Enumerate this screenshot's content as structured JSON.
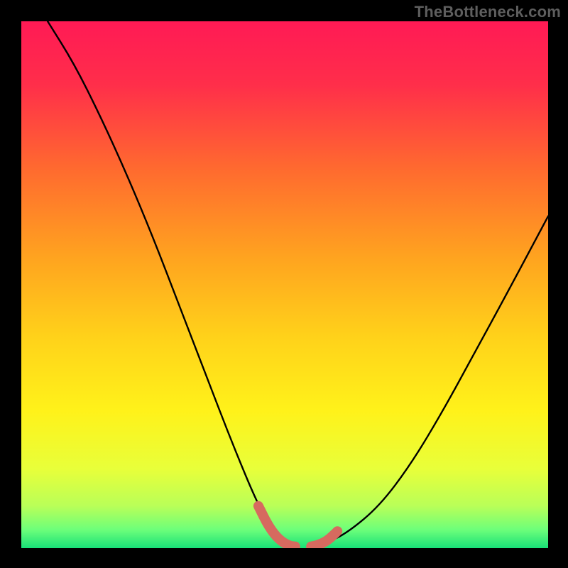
{
  "watermark": "TheBottleneck.com",
  "chart_data": {
    "type": "line",
    "title": "",
    "xlabel": "",
    "ylabel": "",
    "xlim": [
      0,
      100
    ],
    "ylim": [
      0,
      100
    ],
    "grid": false,
    "legend": false,
    "series": [
      {
        "name": "curve-left",
        "x": [
          5,
          10,
          15,
          20,
          25,
          30,
          35,
          40,
          45,
          48,
          50,
          52
        ],
        "y": [
          100,
          92,
          82,
          71,
          59,
          46,
          33,
          20,
          8,
          3,
          1,
          0
        ]
      },
      {
        "name": "curve-right",
        "x": [
          55,
          58,
          62,
          68,
          74,
          80,
          86,
          92,
          100
        ],
        "y": [
          0,
          1,
          3,
          8,
          16,
          26,
          37,
          48,
          63
        ]
      },
      {
        "name": "highlight-left",
        "x": [
          45,
          47,
          49,
          51,
          52
        ],
        "y": [
          8,
          4,
          1.5,
          0.4,
          0.3
        ],
        "stroke": "#d66a5f",
        "width": 14
      },
      {
        "name": "highlight-right",
        "x": [
          55,
          56,
          58,
          60
        ],
        "y": [
          0.3,
          0.5,
          1.3,
          3.2
        ],
        "stroke": "#d66a5f",
        "width": 14
      }
    ],
    "background_gradient": {
      "stops": [
        {
          "offset": 0.0,
          "color": "#ff1a55"
        },
        {
          "offset": 0.12,
          "color": "#ff2e4a"
        },
        {
          "offset": 0.28,
          "color": "#ff6a2f"
        },
        {
          "offset": 0.45,
          "color": "#ffa41f"
        },
        {
          "offset": 0.6,
          "color": "#ffd21a"
        },
        {
          "offset": 0.74,
          "color": "#fff21a"
        },
        {
          "offset": 0.85,
          "color": "#e8ff3a"
        },
        {
          "offset": 0.92,
          "color": "#b9ff58"
        },
        {
          "offset": 0.965,
          "color": "#6dff7a"
        },
        {
          "offset": 1.0,
          "color": "#18e078"
        }
      ]
    }
  }
}
